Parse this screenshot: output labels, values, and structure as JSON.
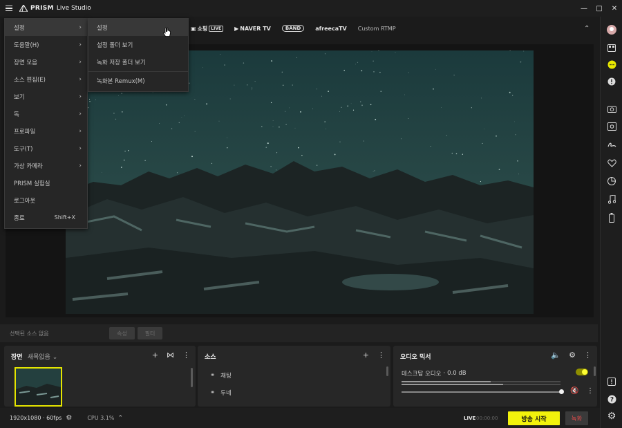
{
  "app": {
    "title": "PRISM Live Studio",
    "title_brand": "PRISM",
    "title_rest": "Live Studio"
  },
  "platforms": [
    {
      "label": "쇼핑",
      "badge": "LIVE",
      "icon": "shopping-icon"
    },
    {
      "label": "NAVER TV",
      "icon": "naver-tv-icon"
    },
    {
      "label": "BAND",
      "icon": "band-icon"
    },
    {
      "label": "afreecaTV",
      "icon": "afreecatv-icon"
    },
    {
      "label": "Custom RTMP",
      "icon": "rtmp-icon"
    }
  ],
  "menu": {
    "items": [
      {
        "label": "설정",
        "submenu": true
      },
      {
        "label": "도움말(H)",
        "submenu": true
      },
      {
        "label": "장면 모음",
        "submenu": true
      },
      {
        "label": "소스 편집(E)",
        "submenu": true
      },
      {
        "label": "보기",
        "submenu": true
      },
      {
        "label": "독",
        "submenu": true
      },
      {
        "label": "프로파일",
        "submenu": true
      },
      {
        "label": "도구(T)",
        "submenu": true
      },
      {
        "label": "가상 카메라",
        "submenu": true
      },
      {
        "label": "PRISM 실험실",
        "submenu": false
      },
      {
        "label": "로그아웃",
        "submenu": false
      },
      {
        "label": "종료",
        "submenu": false,
        "shortcut": "Shift+X"
      }
    ],
    "submenu": [
      {
        "label": "설정"
      },
      {
        "label": "설정 폴더 보기"
      },
      {
        "label": "녹화 저장 폴더 보기"
      },
      {
        "label": "녹화본 Remux(M)"
      }
    ]
  },
  "transition": {
    "label": "선택된 소스 없음",
    "btn_properties": "속성",
    "btn_filter": "필터"
  },
  "scenes": {
    "title": "장면",
    "collection": "새목없음"
  },
  "sources": {
    "title": "소스",
    "items": [
      {
        "label": "채팅"
      },
      {
        "label": "두네"
      }
    ]
  },
  "mixer": {
    "title": "오디오 믹서",
    "channel_name": "데스크탑 오디오",
    "channel_level": "0.0 dB",
    "enabled": true
  },
  "status": {
    "resolution": "1920x1080",
    "fps": "60fps",
    "cpu": "CPU 3.1%",
    "live_label": "LIVE",
    "live_time": "00:00:00",
    "go_live": "방송 시작",
    "record": "녹화"
  },
  "colors": {
    "accent": "#f2f20c",
    "record": "#e04b4b",
    "background": "#1b1b1b"
  },
  "right_sidebar_icons": [
    "avatar-icon",
    "layout-icon",
    "chat-icon",
    "notice-icon",
    "camera-icon",
    "capture-icon",
    "signature-icon",
    "heart-icon",
    "sticker-icon",
    "music-icon",
    "battery-icon",
    "alert-icon",
    "help-icon",
    "settings-icon"
  ]
}
